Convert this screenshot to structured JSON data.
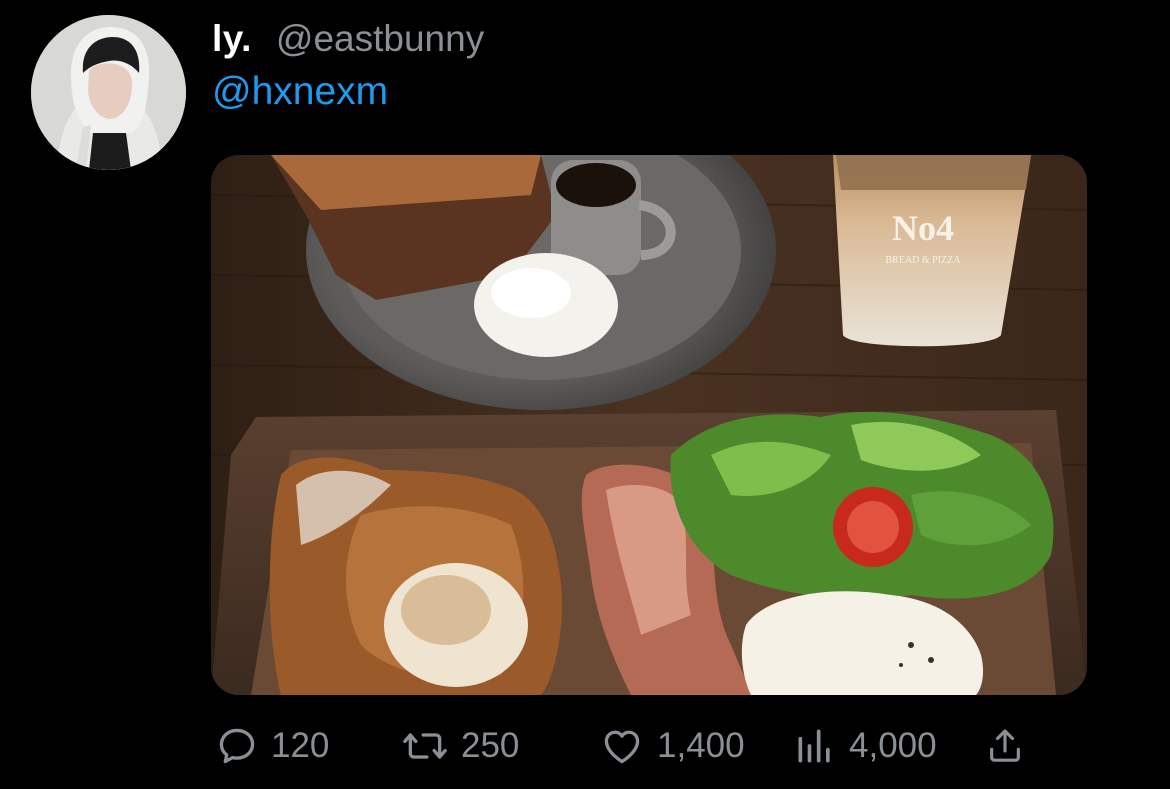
{
  "tweet": {
    "display_name": "ly.",
    "handle": "@eastbunny",
    "body_text": "@hxnexm",
    "avatar_icon": "avatar-icon",
    "accent_color": "#1d9bf0"
  },
  "media": {
    "cup_logo": "No4",
    "cup_text": "BREAD & PIZZA"
  },
  "actions": {
    "reply": {
      "icon": "reply-icon",
      "count": "120"
    },
    "retweet": {
      "icon": "retweet-icon",
      "count": "250"
    },
    "like": {
      "icon": "heart-icon",
      "count": "1,400"
    },
    "views": {
      "icon": "views-icon",
      "count": "4,000"
    },
    "share": {
      "icon": "share-icon"
    }
  }
}
